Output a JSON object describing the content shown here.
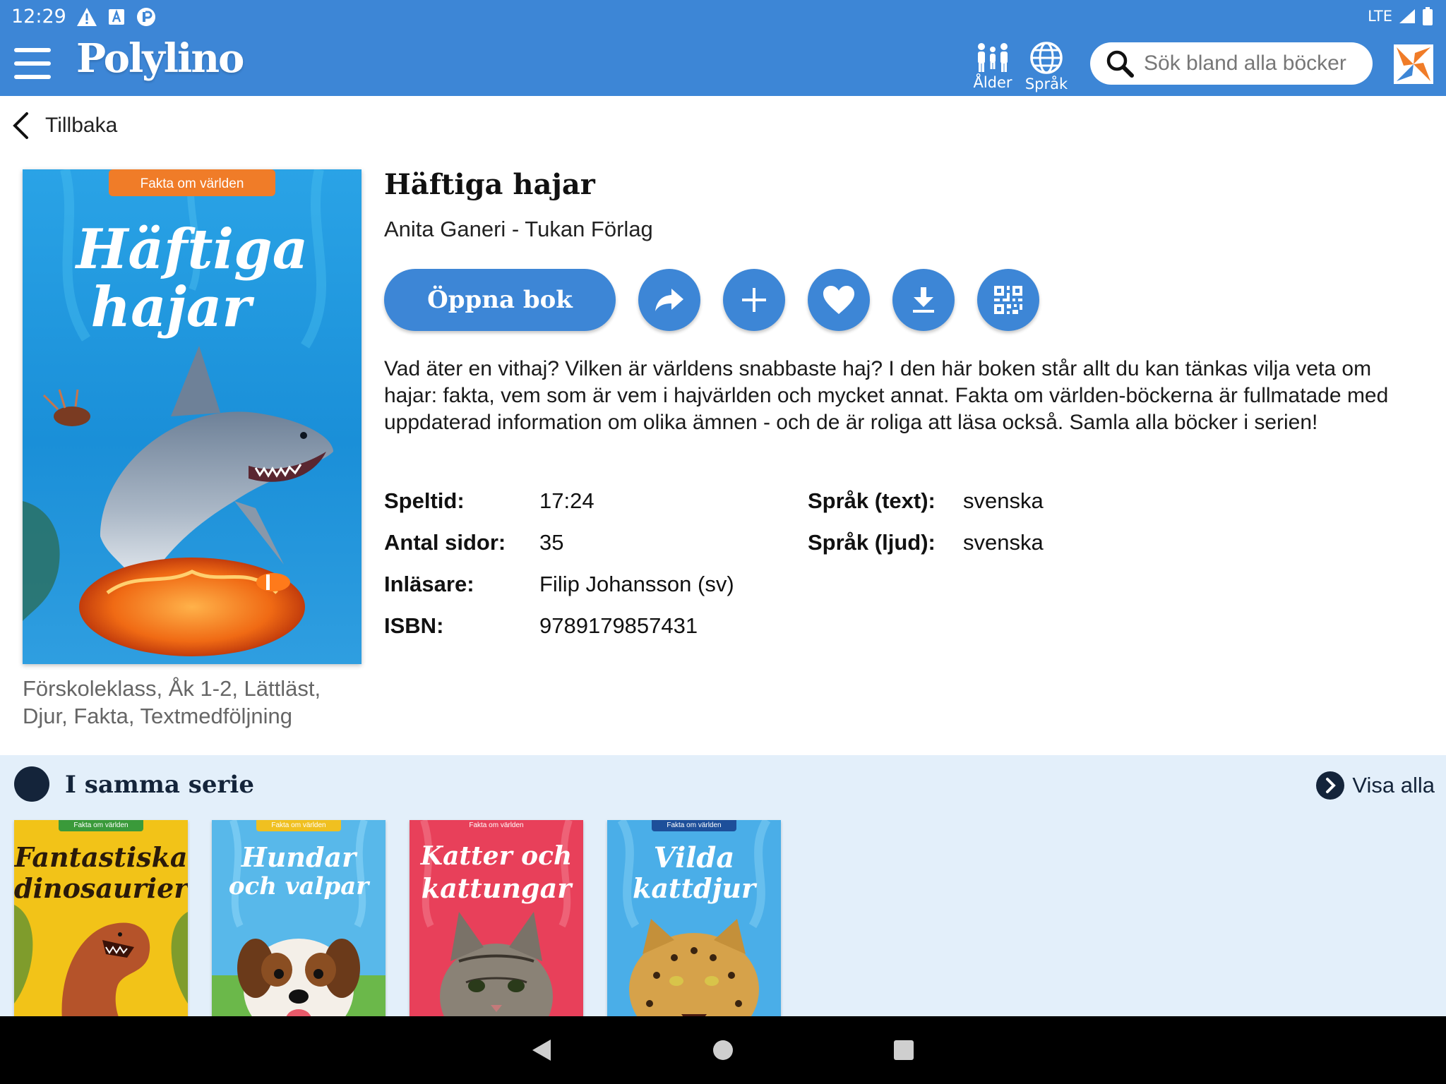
{
  "status": {
    "time": "12:29",
    "network": "LTE"
  },
  "app": {
    "logo": "Polylino"
  },
  "toolbar": {
    "age_label": "Ålder",
    "language_label": "Språk"
  },
  "search": {
    "placeholder": "Sök bland alla böcker"
  },
  "nav": {
    "back_label": "Tillbaka"
  },
  "book": {
    "title": "Häftiga hajar",
    "byline": "Anita Ganeri - Tukan Förlag",
    "open_label": "Öppna bok",
    "description": "Vad äter en vithaj? Vilken är världens snabbaste haj? I den här boken står allt du kan tänkas vilja veta om hajar: fakta, vem som är vem i hajvärlden och mycket annat. Fakta om världen-böckerna är fullmatade med uppdaterad information om olika ämnen - och de är roliga att läsa också. Samla alla böcker i serien!",
    "tags": "Förskoleklass, Åk 1-2, Lättläst, Djur, Fakta, Textmedföljning",
    "cover": {
      "series_band": "Fakta om världen",
      "title_line1": "Häftiga",
      "title_line2": "hajar"
    },
    "meta": {
      "playtime_label": "Speltid:",
      "playtime": "17:24",
      "pages_label": "Antal sidor:",
      "pages": "35",
      "reader_label": "Inläsare:",
      "reader": "Filip Johansson (sv)",
      "isbn_label": "ISBN:",
      "isbn": "9789179857431",
      "lang_text_label": "Språk (text):",
      "lang_text": "svenska",
      "lang_audio_label": "Språk (ljud):",
      "lang_audio": "svenska"
    }
  },
  "series": {
    "title": "I samma serie",
    "show_all": "Visa alla",
    "books": [
      {
        "band": "Fakta om världen",
        "line1": "Fantastiska",
        "line2": "dinosaurier",
        "bg": "#f2c318",
        "band_color": "#3a9a3a",
        "title_color": "#2a1a0a"
      },
      {
        "band": "Fakta om världen",
        "line1": "Hundar",
        "line2": "och valpar",
        "bg": "#58b8ea",
        "band_color": "#f0c020",
        "title_color": "#ffffff"
      },
      {
        "band": "Fakta om världen",
        "line1": "Katter och",
        "line2": "kattungar",
        "bg": "#e8405a",
        "band_color": "#e8405a",
        "title_color": "#ffffff"
      },
      {
        "band": "Fakta om världen",
        "line1": "Vilda",
        "line2": "kattdjur",
        "bg": "#4aaee8",
        "band_color": "#1d4f9a",
        "title_color": "#ffffff"
      }
    ]
  },
  "colors": {
    "primary": "#3d86d6",
    "series_bg": "#e3effa",
    "dark": "#14243a",
    "logo_orange": "#f07c28"
  }
}
